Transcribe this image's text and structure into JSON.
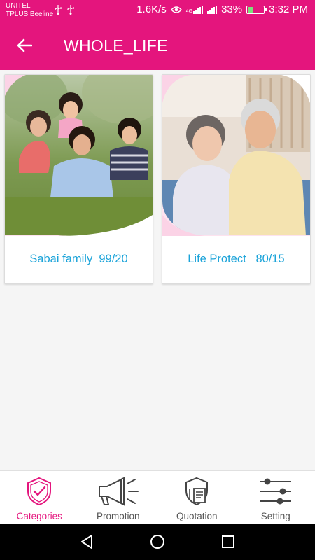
{
  "status_bar": {
    "carrier_line1": "UNITEL",
    "carrier_line2": "TPLUS|Beeline",
    "speed": "1.6K/s",
    "battery": "33%",
    "time": "3:32 PM",
    "network_badge": "4G"
  },
  "app_bar": {
    "title": "WHOLE_LIFE",
    "back_icon": "arrow-left-icon"
  },
  "products": [
    {
      "label": "Sabai family  99/20",
      "image": "family-photo"
    },
    {
      "label": "Life Protect   80/15",
      "image": "elderly-couple-photo"
    }
  ],
  "bottom_nav": {
    "items": [
      {
        "label": "Categories",
        "icon": "shield-check-icon",
        "active": true
      },
      {
        "label": "Promotion",
        "icon": "megaphone-icon",
        "active": false
      },
      {
        "label": "Quotation",
        "icon": "shield-document-icon",
        "active": false
      },
      {
        "label": "Setting",
        "icon": "sliders-icon",
        "active": false
      }
    ]
  },
  "colors": {
    "primary": "#e4157d",
    "link": "#1aa3d9",
    "inactive": "#555555"
  }
}
